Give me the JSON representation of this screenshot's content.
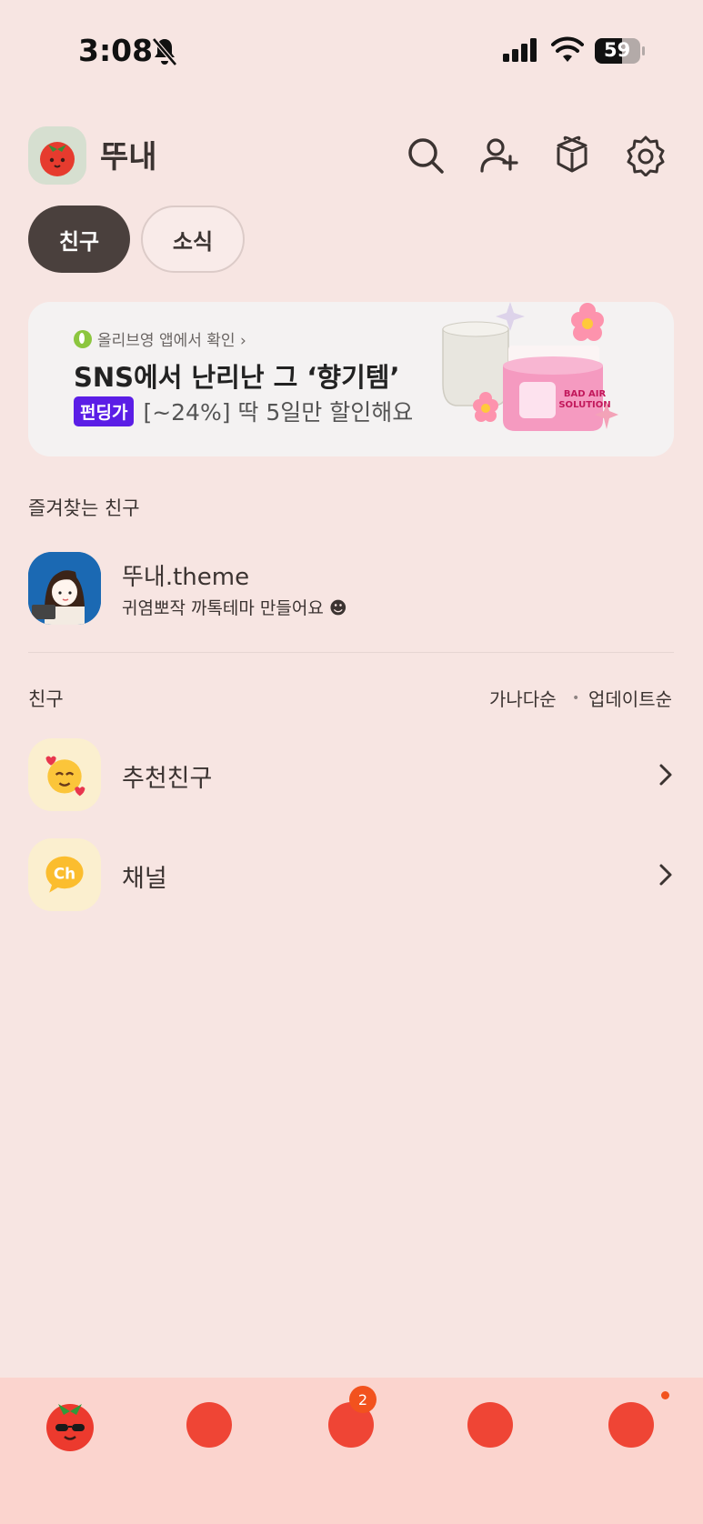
{
  "status_bar": {
    "time": "3:08",
    "battery": "59"
  },
  "header": {
    "profile_name": "뚜내"
  },
  "tabs": [
    {
      "label": "친구",
      "active": true
    },
    {
      "label": "소식",
      "active": false
    }
  ],
  "banner": {
    "source": "올리브영 앱에서 확인 ›",
    "title": "SNS에서 난리난 그 ‘향기템’",
    "badge": "펀딩가",
    "subtitle": "[~24%] 딱 5일만 할인해요"
  },
  "favorites": {
    "label": "즐겨찾는 친구",
    "items": [
      {
        "name": "뚜내.theme",
        "status": "귀염뽀작 까톡테마 만들어요 ☻"
      }
    ]
  },
  "friends": {
    "label": "친구",
    "sort_options": [
      "가나다순",
      "업데이트순"
    ],
    "sort_separator": "•",
    "rows": [
      {
        "label": "추천친구",
        "icon": "smiling-hearts-icon"
      },
      {
        "label": "채널",
        "icon": "ch-icon"
      }
    ],
    "channel_icon_text": "Ch"
  },
  "bottom_nav": {
    "badge_count": "2"
  },
  "colors": {
    "background": "#f7e5e2",
    "accent": "#f2521e",
    "tab_active": "#4a403d",
    "badge": "#5b1ee6"
  }
}
